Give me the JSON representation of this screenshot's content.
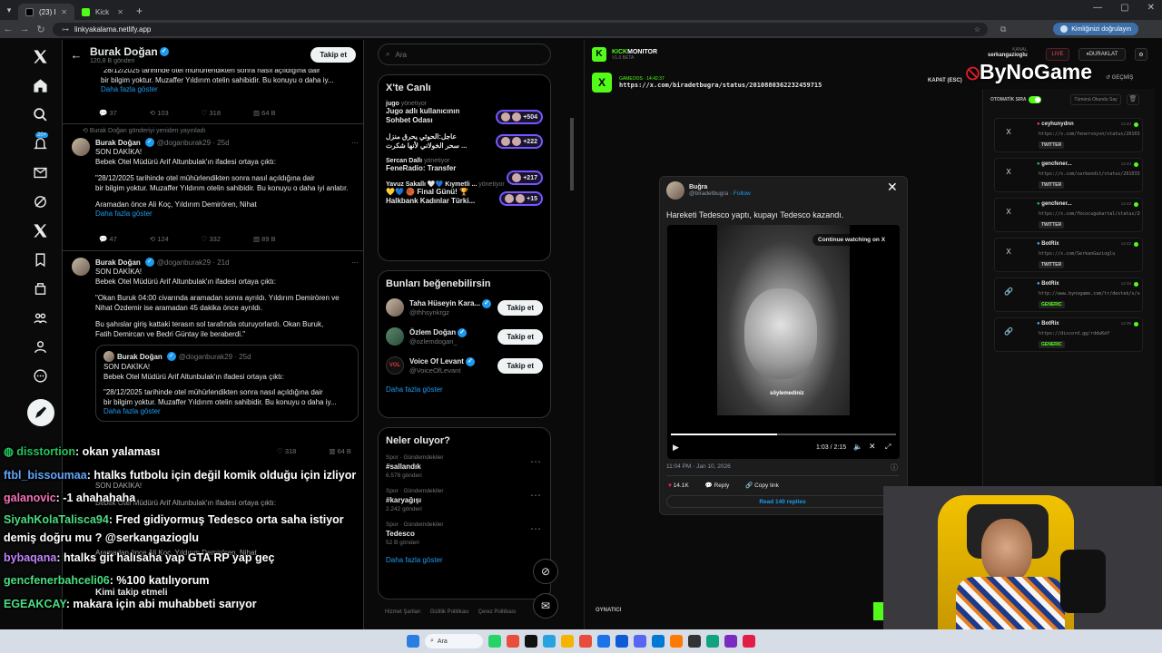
{
  "browser": {
    "tabs": [
      {
        "label": "(23) Burak"
      },
      {
        "label": "Kick Link"
      }
    ],
    "url": "linkyakalama.netlify.app",
    "profile_label": "Kimliğinizi doğrulayın"
  },
  "xnav": {
    "badge": "20+"
  },
  "profile_header": {
    "name": "Burak Doğan",
    "posts": "120,8 B gönderi",
    "follow": "Takip et"
  },
  "tweets": {
    "t0": {
      "line1": "\"28/12/2025 tarihinde otel mühürlendikten sonra nasıl açıldığına dair",
      "line2": "bir bilgim yoktur. Muzaffer Yıldırım otelin sahibidir. Bu konuyu o daha iy...",
      "more": "Daha fazla göster",
      "replies": "37",
      "reposts": "103",
      "likes": "318",
      "views": "64 B"
    },
    "t1": {
      "repost_note": "Burak Doğan gönderiyi yeniden yayınladı",
      "name": "Burak Doğan",
      "handle": "@doganburak29 · 25d",
      "l1": "SON DAKİKA!",
      "l2": "Bebek Otel Müdürü Arif Altunbulak'ın ifadesi ortaya çıktı:",
      "l3": "\"28/12/2025 tarihinde otel mühürlendikten sonra nasıl açıldığına dair",
      "l4": "bir bilgim yoktur. Muzaffer Yıldırım otelin sahibidir. Bu konuyu o daha iyi anlatır.",
      "l5": "Aramadan önce Ali Koç, Yıldırım Demirören, Nihat",
      "more": "Daha fazla göster",
      "replies": "47",
      "reposts": "124",
      "likes": "332",
      "views": "89 B"
    },
    "t2": {
      "name": "Burak Doğan",
      "handle": "@doganburak29 · 21d",
      "l1": "SON DAKİKA!",
      "l2": "Bebek Otel Müdürü Arif Altunbulak'ın ifadesi ortaya çıktı:",
      "l3": "\"Okan Buruk 04:00 civarında aramadan sonra ayrıldı. Yıldırım Demirören ve",
      "l4": "Nihat Özdemir ise aramadan 45 dakika önce ayrıldı.",
      "l5": "Bu şahıslar giriş kattaki terasın sol tarafında oturuyorlardı. Okan Buruk,",
      "l6": "Fatih Demircan ve Bedri Güntay ile beraberdi.\"",
      "q_name": "Burak Doğan",
      "q_handle": "@doganburak29 · 25d",
      "q1": "SON DAKİKA!",
      "q2": "Bebek Otel Müdürü Arif Altunbulak'ın ifadesi ortaya çıktı:",
      "q3": "\"28/12/2025 tarihinde otel mühürlendikten sonra nasıl açıldığına dair",
      "q4": "bir bilgim yoktur. Muzaffer Yıldırım otelin sahibidir. Bu konuyu o daha iy...",
      "q_more": "Daha fazla göster",
      "likes": "318",
      "views": "64 B"
    },
    "t3": {
      "l1": "SON DAKİKA!",
      "l2": "Bebek Otel Müdürü Arif Altunbulak'ın ifadesi ortaya çıktı:",
      "l3": "Aramadan önce Ali Koç, Yıldırım Demirören, Nihat",
      "follow_title": "Kimi takip etmeli"
    }
  },
  "search": {
    "placeholder": "Ara"
  },
  "live": {
    "title": "X'te Canlı",
    "items": [
      {
        "user": "jugo",
        "role": "yönetiyor",
        "text1": "Jugo adlı kullanıcının",
        "text2": "Sohbet Odası",
        "count": "+504"
      },
      {
        "user": "",
        "role": "",
        "text1": "عاجل:الحوثي يحرق منزل",
        "text2": "سحر الخولاني لأنها شكرت ...",
        "count": "+222"
      },
      {
        "user": "Sercan Dallı",
        "role": "yönetiyor",
        "text1": "FeneRadio: Transfer",
        "text2": "",
        "count": "+217"
      },
      {
        "user": "Yavuz Sakallı 🤍💙 Kıymetli ...",
        "role": "yönetiyor",
        "text1": "💛💙 🏀 Final Günü! 🏆",
        "text2": "Halkbank Kadınlar Türki...",
        "count": "+15"
      }
    ]
  },
  "suggestions": {
    "title": "Bunları beğenebilirsin",
    "items": [
      {
        "name": "Taha Hüseyin Kara...",
        "handle": "@thhsynkrgz",
        "btn": "Takip et"
      },
      {
        "name": "Özlem Doğan",
        "handle": "@ozlemdogan_",
        "btn": "Takip et"
      },
      {
        "name": "Voice Of Levant",
        "handle": "@VoiceOfLevant",
        "btn": "Takip et"
      }
    ],
    "more": "Daha fazla göster"
  },
  "trends": {
    "title": "Neler oluyor?",
    "items": [
      {
        "cat": "Spor · Gündemdekiler",
        "name": "#sallandık",
        "posts": "6.578 gönderi"
      },
      {
        "cat": "Spor · Gündemdekiler",
        "name": "#karyağışı",
        "posts": "2.242 gönderi"
      },
      {
        "cat": "Spor · Gündemdekiler",
        "name": "Tedesco",
        "posts": "52 B gönderi"
      }
    ],
    "more": "Daha fazla göster"
  },
  "footer_links": [
    "Hizmet Şartları",
    "Gizlilik Politikası",
    "Çerez Politikası"
  ],
  "chat": [
    {
      "user": "disstortion",
      "msg": ": okan yalaması",
      "color": "#22c55e"
    },
    {
      "user": "ftbl_bissoumaa",
      "msg": ": htalks futbolu için değil komik olduğu için izliyor",
      "color": "#60a5fa"
    },
    {
      "user": "galanovic",
      "msg": ": -1 ahahahaha",
      "color": "#f472b6"
    },
    {
      "user": "SiyahKolaTalisca94",
      "msg": ": Fred gidiyormuş Tedesco orta saha istiyor",
      "color": "#4ade80"
    },
    {
      "user": "",
      "msg": "demiş doğru mu ? @serkangazioglu",
      "color": "#ffffff"
    },
    {
      "user": "bybaqana",
      "msg": ": htalks git halısaha yap GTA RP yap geç",
      "color": "#c084fc"
    },
    {
      "user": "gencfenerbahceli06",
      "msg": ": %100 katılıyorum",
      "color": "#4ade80"
    },
    {
      "user": "EGEAKCAY",
      "msg": ": makara için abi muhabbeti sarıyor",
      "color": "#4ade80"
    }
  ],
  "kick": {
    "brand_a": "KICK",
    "brand_b": "MONITOR",
    "version": "V1.0 BETA",
    "channel_label": "KANAL",
    "channel": "serkangazioglu",
    "live": "LIVE",
    "pause": "DURAKLAT",
    "history": "GEÇMİŞ",
    "sender_label": "GAMEOOS · 14:42:37",
    "current_url": "https://x.com/biradetbugra/status/2010880362232459715",
    "close": "KAPAT (ESC)",
    "autoplay": "OTOMATİK SIRA",
    "mark_all": "Tümünü Okundu Say",
    "player": "OYNATICI",
    "watermark": "ByNoGame",
    "queue": [
      {
        "name": "ceyhunydnn",
        "link": "https://x.com/fenervoyvn/status/20103415531...",
        "tag": "TWITTER",
        "icon": "X",
        "time": "14:44"
      },
      {
        "name": "gencfener...",
        "link": "https://x.com/sarkendit/status/2010335417...",
        "tag": "TWITTER",
        "icon": "X",
        "time": "14:44"
      },
      {
        "name": "gencfener...",
        "link": "https://x.com/fbcocugukartal/status/20103...",
        "tag": "TWITTER",
        "icon": "X",
        "time": "14:43"
      },
      {
        "name": "BotRix",
        "link": "https://x.com/SerkanGazioglu",
        "tag": "TWITTER",
        "icon": "X",
        "time": "14:42"
      },
      {
        "name": "BotRix",
        "link": "http://www.bynogame.com/tr/destek/x/serkan...",
        "tag": "GENERIC",
        "icon": "🔗",
        "time": "14:34"
      },
      {
        "name": "BotRix",
        "link": "https://discord.gg/rdduKeY",
        "tag": "GENERIC",
        "icon": "🔗",
        "time": "14:30"
      }
    ]
  },
  "embed": {
    "name": "Buğra",
    "handle": "@biradetbugra",
    "follow": "Follow",
    "text": "Hareketi Tedesco yaptı, kupayı Tedesco kazandı.",
    "cwo": "Continue watching on X",
    "time": "1:03 / 2:15",
    "caption": "söylemediniz",
    "date": "11:04 PM · Jan 10, 2026",
    "likes": "14.1K",
    "reply": "Reply",
    "copy": "Copy link",
    "read": "Read 140 replies"
  },
  "taskbar": {
    "search": "Ara"
  }
}
